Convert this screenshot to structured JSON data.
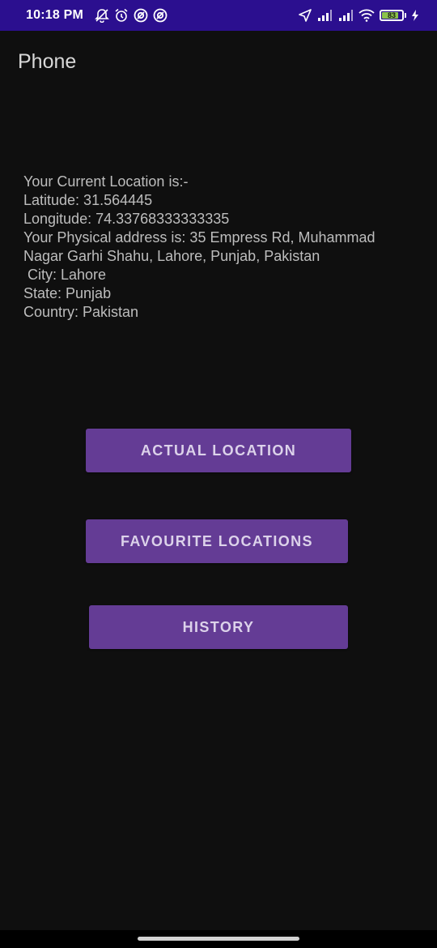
{
  "status_bar": {
    "time": "10:18 PM",
    "battery_level": "83",
    "battery_color": "#8bc34a",
    "left_icons": [
      "notifications-off-icon",
      "alarm-icon",
      "app-notification-icon",
      "app-notification-icon"
    ],
    "right_icons": [
      "location-arrow-icon",
      "signal-icon",
      "signal-icon",
      "wifi-icon",
      "battery-icon",
      "charging-icon"
    ]
  },
  "app": {
    "title": "Phone"
  },
  "location": {
    "line1": "Your Current Location is:-",
    "line2": "Latitude: 31.564445",
    "line3": "Longitude: 74.33768333333335",
    "line4": "Your Physical address is: 35 Empress Rd, Muhammad Nagar Garhi Shahu, Lahore, Punjab, Pakistan",
    "line5": " City: Lahore",
    "line6": "State: Punjab",
    "line7": "Country: Pakistan"
  },
  "buttons": {
    "actual_location": "ACTUAL LOCATION",
    "favourite_locations": "FAVOURITE LOCATIONS",
    "history": "HISTORY"
  },
  "colors": {
    "status_bar": "#2b0f8f",
    "background": "#0f0f0f",
    "button": "#643c95"
  }
}
